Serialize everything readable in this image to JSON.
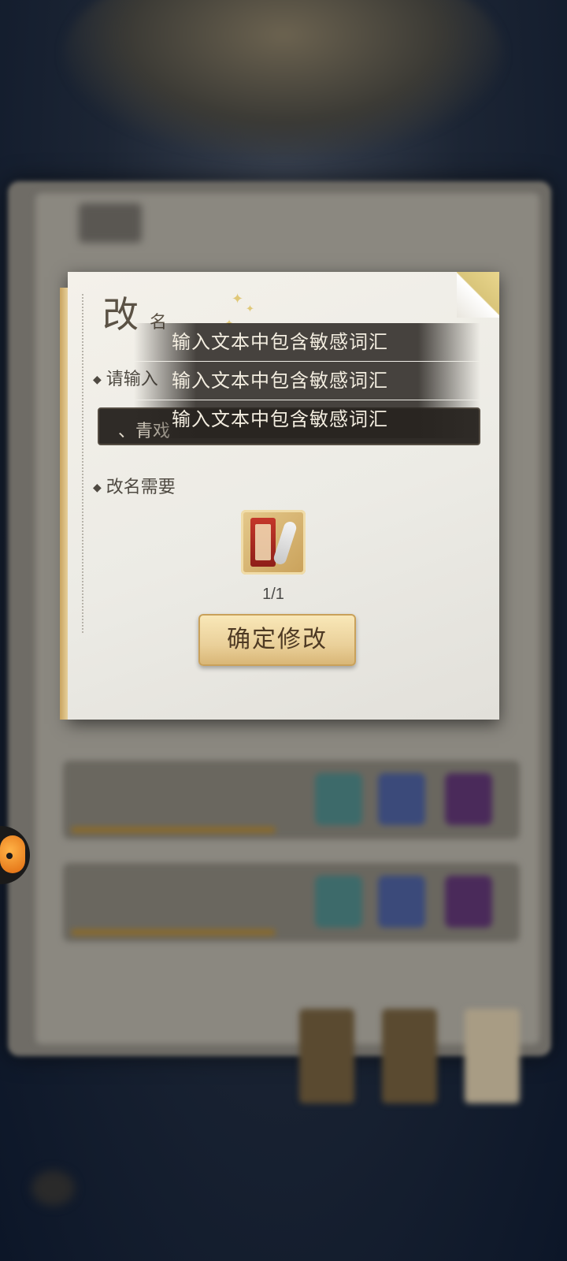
{
  "dialog": {
    "title_char_big": "改",
    "title_char_small": "名",
    "prompt_label": "请输入",
    "name_input_value": "、青戏",
    "cost_label": "改名需要",
    "item": {
      "icon": "rename-scroll-icon",
      "count": "1/1"
    },
    "confirm_button": "确定修改"
  },
  "toasts": [
    "输入文本中包含敏感词汇",
    "输入文本中包含敏感词汇",
    "输入文本中包含敏感词汇"
  ],
  "colors": {
    "dialog_bg": "#f4f1ea",
    "toast_bg": "#28241f",
    "button_gold": "#ead09a",
    "text_dark": "#4f4a42"
  }
}
